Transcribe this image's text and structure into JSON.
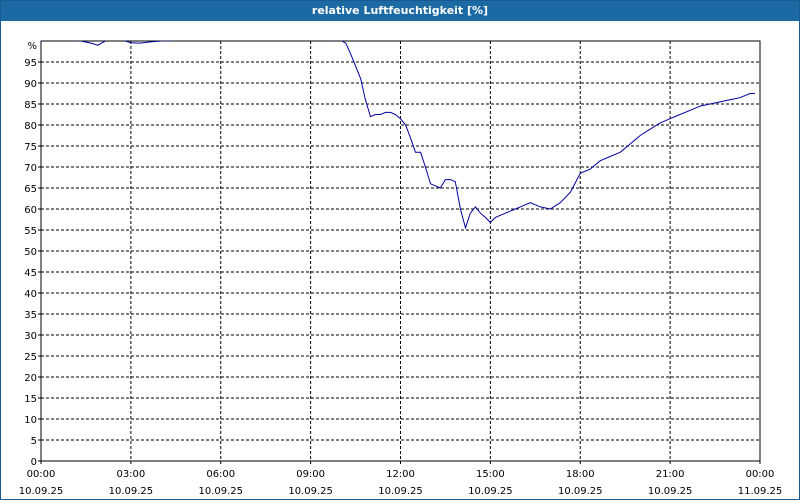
{
  "header": {
    "title": "relative Luftfeuchtigkeit [%]"
  },
  "colors": {
    "titlebar": "#1c6aa3",
    "line": "#0000a0",
    "grid": "#000000"
  },
  "chart_data": {
    "type": "line",
    "title": "relative Luftfeuchtigkeit [%]",
    "ylabel": "%",
    "xlabel": "",
    "ylim": [
      0,
      100
    ],
    "grid": true,
    "y_ticks": [
      0,
      5,
      10,
      15,
      20,
      25,
      30,
      35,
      40,
      45,
      50,
      55,
      60,
      65,
      70,
      75,
      80,
      85,
      90,
      95
    ],
    "y_top_label": "%",
    "x_ticks": [
      {
        "time": "00:00",
        "date": "10.09.25",
        "hour": 0
      },
      {
        "time": "03:00",
        "date": "10.09.25",
        "hour": 3
      },
      {
        "time": "06:00",
        "date": "10.09.25",
        "hour": 6
      },
      {
        "time": "09:00",
        "date": "10.09.25",
        "hour": 9
      },
      {
        "time": "12:00",
        "date": "10.09.25",
        "hour": 12
      },
      {
        "time": "15:00",
        "date": "10.09.25",
        "hour": 15
      },
      {
        "time": "18:00",
        "date": "10.09.25",
        "hour": 18
      },
      {
        "time": "21:00",
        "date": "10.09.25",
        "hour": 21
      },
      {
        "time": "00:00",
        "date": "11.09.25",
        "hour": 24
      }
    ],
    "series": [
      {
        "x": [
          0,
          0.33,
          0.67,
          1.0,
          1.33,
          1.67,
          1.9,
          2.2,
          2.5,
          2.8,
          3.0,
          3.3,
          3.7,
          4.0,
          4.3,
          4.7,
          5.0,
          5.5,
          6.0,
          7.0,
          8.0,
          9.0,
          9.33,
          9.67,
          9.83,
          10.0,
          10.17,
          10.33,
          10.5,
          10.67,
          10.83,
          11.0,
          11.17,
          11.33,
          11.5,
          11.67,
          11.83,
          12.0,
          12.17,
          12.33,
          12.5,
          12.67,
          12.83,
          13.0,
          13.17,
          13.33,
          13.5,
          13.67,
          13.83,
          14.0,
          14.17,
          14.33,
          14.5,
          14.67,
          14.83,
          15.0,
          15.17,
          15.33,
          15.5,
          15.67,
          15.83,
          16.0,
          16.33,
          16.67,
          17.0,
          17.33,
          17.67,
          18.0,
          18.33,
          18.67,
          19.0,
          19.33,
          19.67,
          20.0,
          20.33,
          20.67,
          21.0,
          21.33,
          21.67,
          22.0,
          22.33,
          22.67,
          23.0,
          23.33,
          23.67,
          23.83
        ],
        "values": [
          100,
          100.2,
          100.4,
          100.2,
          100.0,
          99.5,
          99.0,
          100.2,
          100.6,
          100.0,
          99.6,
          99.5,
          99.8,
          100.0,
          100.0,
          100.3,
          100.5,
          100.5,
          100.5,
          100.5,
          100.5,
          100.5,
          100.4,
          100.0,
          100.5,
          100.2,
          99.5,
          97,
          94,
          91,
          86,
          82,
          82.5,
          82.5,
          83,
          83,
          82.5,
          81.5,
          80,
          77,
          73.5,
          73.5,
          70,
          66,
          65.5,
          65,
          67,
          67,
          66.5,
          60,
          55.5,
          59,
          60.5,
          59,
          58,
          56.8,
          58,
          58.5,
          59,
          59.5,
          60,
          60.5,
          61.5,
          60.5,
          60.0,
          61.5,
          64,
          68.5,
          69.5,
          71.5,
          72.5,
          73.5,
          75.5,
          77.5,
          79,
          80.5,
          81.5,
          82.5,
          83.5,
          84.5,
          85,
          85.5,
          86,
          86.5,
          87.5,
          87.5
        ]
      }
    ]
  }
}
